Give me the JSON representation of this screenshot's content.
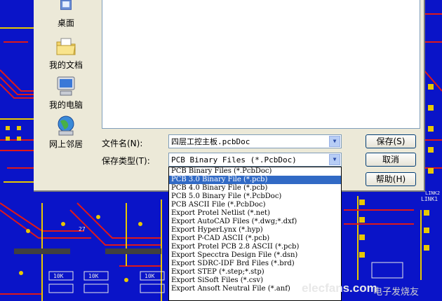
{
  "places": [
    {
      "label": "桌面",
      "icon": "desktop-icon"
    },
    {
      "label": "我的文档",
      "icon": "my-documents-icon"
    },
    {
      "label": "我的电脑",
      "icon": "my-computer-icon"
    },
    {
      "label": "网上邻居",
      "icon": "network-places-icon"
    }
  ],
  "form": {
    "filename_label": "文件名(N):",
    "filename_value": "四层工控主板.pcbDoc",
    "filetype_label": "保存类型(T):",
    "filetype_value": "PCB Binary Files (*.PcbDoc)"
  },
  "buttons": {
    "save": "保存(S)",
    "cancel": "取消",
    "help": "帮助(H)"
  },
  "filetype_options": [
    "PCB Binary Files (*.PcbDoc)",
    "PCB 3.0 Binary File (*.pcb)",
    "PCB 4.0 Binary File (*.pcb)",
    "PCB 5.0 Binary File (*.PcbDoc)",
    "PCB ASCII File (*.PcbDoc)",
    "Export Protel Netlist (*.net)",
    "Export AutoCAD Files (*.dwg;*.dxf)",
    "Export HyperLynx (*.hyp)",
    "Export P-CAD ASCII (*.pcb)",
    "Export Protel PCB 2.8 ASCII (*.pcb)",
    "Export Specctra Design File (*.dsn)",
    "Export SDRC-IDF Brd Files (*.brd)",
    "Export STEP (*.step;*.stp)",
    "Export SiSoft Files (*.csv)",
    "Export Ansoft Neutral File (*.anf)"
  ],
  "selected_option_index": 1,
  "pcb_labels": {
    "link1": "LINK1",
    "link2": "LINK2",
    "n27": "27",
    "r10k": "10K"
  },
  "watermark": {
    "text": "elecfans.com",
    "cn": "电子发烧友"
  },
  "colors": {
    "pcb_blue": "#0a14c8",
    "trace_red": "#e01818",
    "pad_yellow": "#e8c800",
    "selection": "#316ac5"
  }
}
